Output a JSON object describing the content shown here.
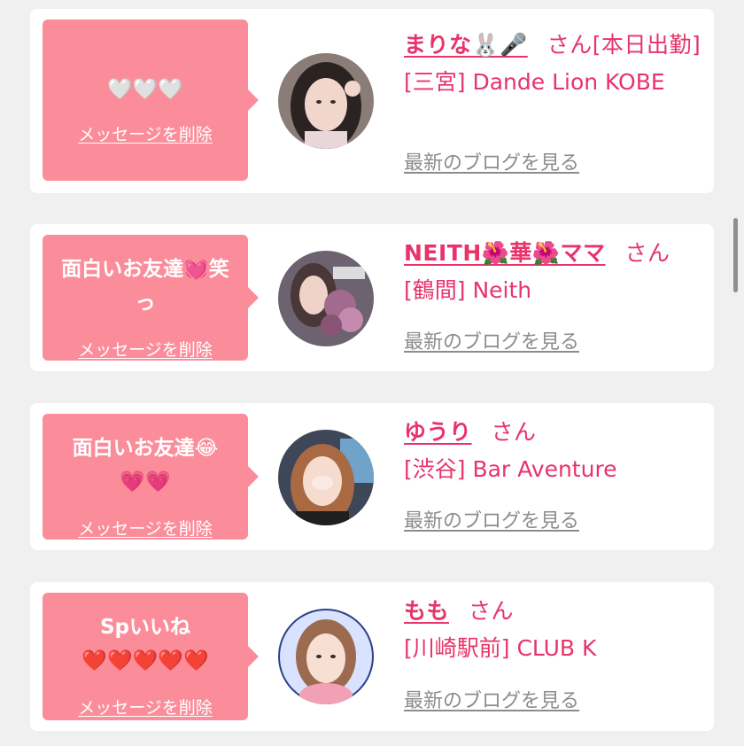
{
  "colors": {
    "background": "#f0f0f1",
    "card": "#ffffff",
    "bubble": "#fb8d9b",
    "accent": "#e8336b",
    "link_gray": "#8c8c8c"
  },
  "items": [
    {
      "message": "🤍🤍🤍",
      "delete_label": "メッセージを削除",
      "avatar_icon": "girl-photo-avatar",
      "name": "まりな🐰🎤",
      "suffix": "さん[本日出勤]",
      "shop": "[三宮] Dande Lion KOBE",
      "blog_label": "最新のブログを見る"
    },
    {
      "message": "面白いお友達💓笑\nっ",
      "delete_label": "メッセージを削除",
      "avatar_icon": "girl-with-flowers-avatar",
      "name": "NEITH🌺華🌺ママ",
      "suffix": "さん",
      "shop": "[鶴間] Neith",
      "blog_label": "最新のブログを見る"
    },
    {
      "message": "面白いお友達😂\n💗💗",
      "delete_label": "メッセージを削除",
      "avatar_icon": "girl-selfie-avatar",
      "name": "ゆうり",
      "suffix": "さん",
      "shop": "[渋谷] Bar Aventure",
      "blog_label": "最新のブログを見る"
    },
    {
      "message": "Spいいね\n❤️❤️❤️❤️❤️",
      "delete_label": "メッセージを削除",
      "avatar_icon": "girl-portrait-avatar",
      "name": "もも",
      "suffix": "さん",
      "shop": "[川崎駅前] CLUB K",
      "blog_label": "最新のブログを見る"
    }
  ]
}
